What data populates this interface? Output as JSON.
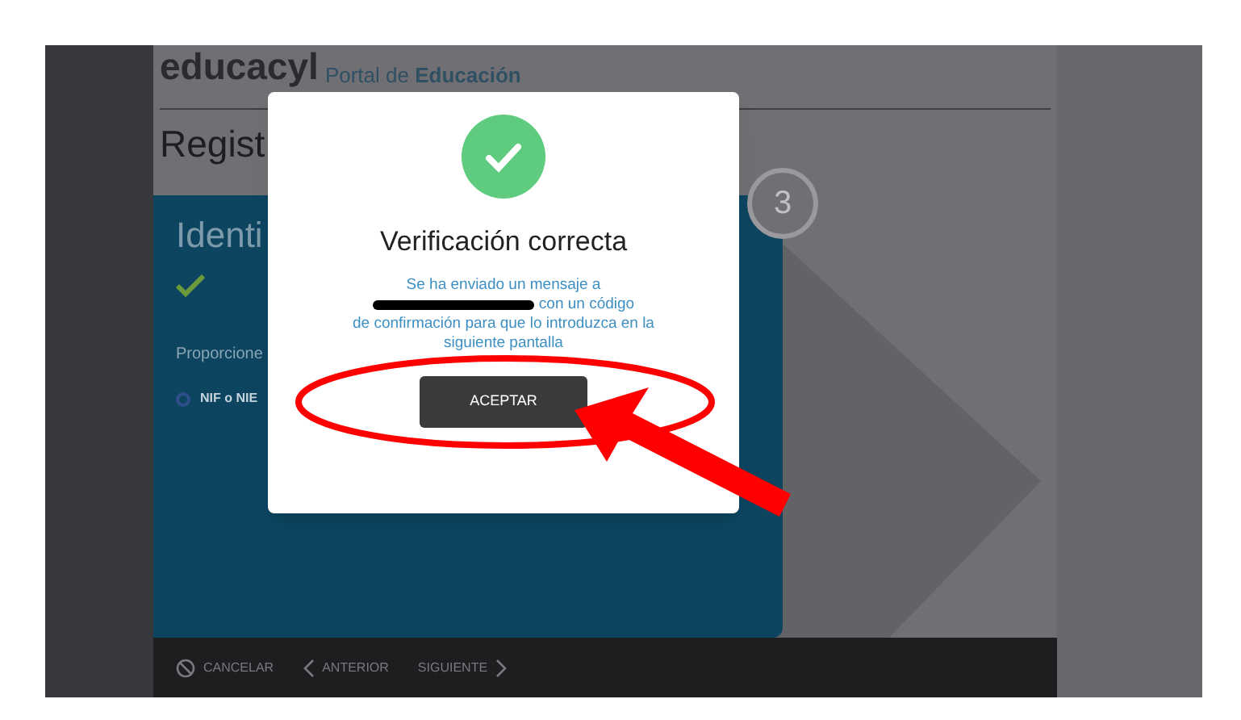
{
  "header": {
    "logo": "educacyl",
    "portal": "Portal de **Educación**"
  },
  "page_title": "Regist",
  "step": {
    "number": "3"
  },
  "panel": {
    "title": "Identi",
    "checked": true,
    "prompt": "Proporcione",
    "options": [
      {
        "label": "NIF o NIE",
        "selected": false
      }
    ]
  },
  "footer": {
    "buttons": [
      {
        "label": "CANCELAR",
        "kind": "cancel"
      },
      {
        "label": "ANTERIOR",
        "kind": "back"
      },
      {
        "label": "SIGUIENTE",
        "kind": "next"
      }
    ]
  },
  "modal": {
    "title": "Verificación correcta",
    "message_start": "Se ha enviado un mensaje a",
    "email_redacted": true,
    "message_after_email": "con un código",
    "message_end": "de confirmación para que lo introduzca en la siguiente pantalla",
    "button": "ACEPTAR"
  }
}
